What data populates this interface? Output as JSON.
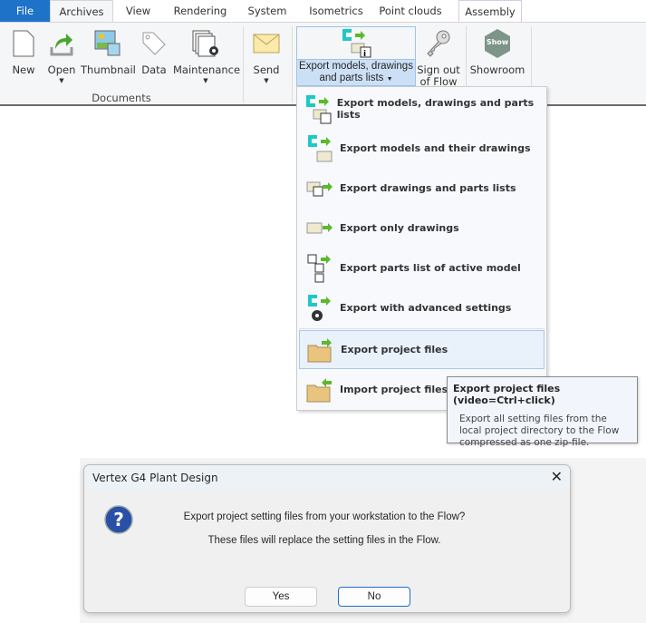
{
  "tabs": [
    "File",
    "Archives",
    "View",
    "Rendering",
    "System",
    "Isometrics",
    "Point clouds",
    "Assembly"
  ],
  "ribbon": {
    "new": "New",
    "open": "Open",
    "thumbnail": "Thumbnail",
    "data": "Data",
    "maintenance": "Maintenance",
    "send": "Send",
    "export_line1": "Export models, drawings",
    "export_line2": "and parts lists",
    "signout_line1": "Sign out",
    "signout_line2": "of Flow",
    "showroom": "Showroom",
    "group_documents": "Documents"
  },
  "menu": [
    "Export models, drawings and parts lists",
    "Export models and their drawings",
    "Export drawings and parts lists",
    "Export only drawings",
    "Export parts list of active model",
    "Export with advanced settings",
    "Export project files",
    "Import project files"
  ],
  "tooltip": {
    "title": "Export project files (video=Ctrl+click)",
    "l1": "Export all setting files from the",
    "l2": "local project directory to the Flow",
    "l3": "compressed as one zip-file."
  },
  "dialog": {
    "title": "Vertex G4 Plant Design",
    "message": "Export project setting files from your workstation to the Flow?",
    "detail": "These files will replace the setting files in the Flow.",
    "yes": "Yes",
    "no": "No"
  },
  "colors": {
    "file_tab": "#1e73c8",
    "highlight": "#cce0f5"
  }
}
